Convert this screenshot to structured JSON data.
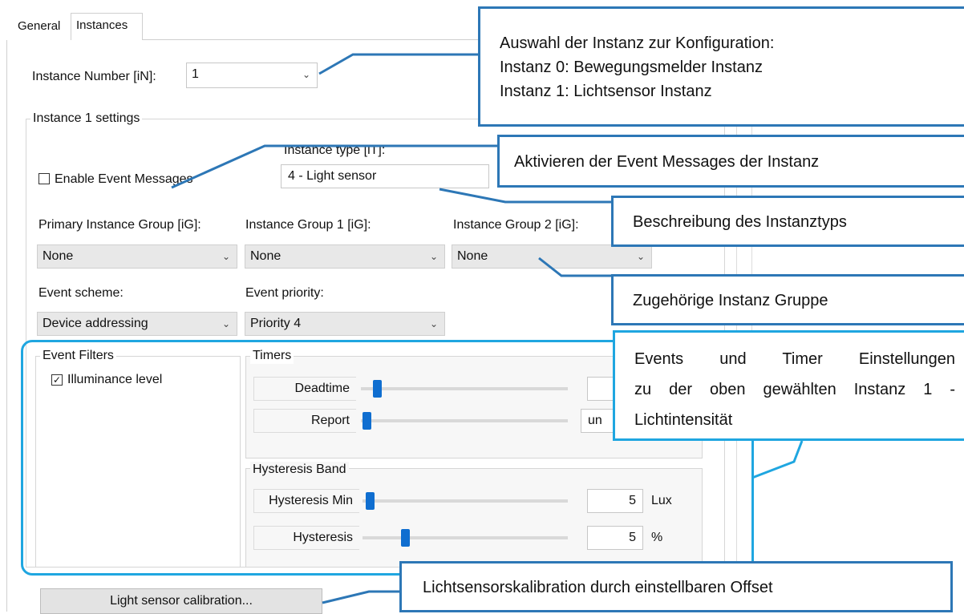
{
  "tabs": [
    "General",
    "Instances"
  ],
  "instance_number": {
    "label": "Instance Number [iN]:",
    "value": "1"
  },
  "instance_settings": {
    "title": "Instance 1 settings",
    "enable_event_messages": {
      "label": "Enable Event Messages",
      "checked": false
    },
    "instance_type": {
      "label": "Instance type [iT]:",
      "value": "4 - Light sensor"
    },
    "primary_group": {
      "label": "Primary Instance Group [iG]:",
      "value": "None"
    },
    "group1": {
      "label": "Instance Group 1 [iG]:",
      "value": "None"
    },
    "group2": {
      "label": "Instance Group 2 [iG]:",
      "value": "None"
    },
    "event_scheme": {
      "label": "Event scheme:",
      "value": "Device addressing"
    },
    "event_priority": {
      "label": "Event priority:",
      "value": "Priority 4"
    }
  },
  "event_filters": {
    "title": "Event Filters",
    "illuminance": {
      "label": "Illuminance level",
      "checked": true
    }
  },
  "timers": {
    "title": "Timers",
    "deadtime": {
      "label": "Deadtime",
      "value": "("
    },
    "report": {
      "label": "Report",
      "value": "un"
    }
  },
  "hysteresis": {
    "title": "Hysteresis Band",
    "min": {
      "label": "Hysteresis Min",
      "value": "5",
      "unit": "Lux"
    },
    "hyst": {
      "label": "Hysteresis",
      "value": "5",
      "unit": "%"
    }
  },
  "calibration_button": "Light sensor calibration...",
  "callouts": {
    "instance_selection": [
      "Auswahl der Instanz zur Konfiguration:",
      "Instanz 0: Bewegungsmelder Instanz",
      "Instanz 1: Lichtsensor Instanz"
    ],
    "event_messages": "Aktivieren der Event Messages der Instanz",
    "instance_type_desc": "Beschreibung des Instanztyps",
    "instance_group": "Zugehörige Instanz Gruppe",
    "events_timers": [
      "Events und Timer Einstellungen",
      "zu der oben gewählten Instanz 1 -",
      "Lichtintensität"
    ],
    "calibration": "Lichtsensorskalibration durch einstellbaren Offset"
  },
  "colors": {
    "callout_border": "#2d77b6",
    "highlight_border": "#1fa6e0",
    "slider_thumb": "#0f6ed0"
  }
}
